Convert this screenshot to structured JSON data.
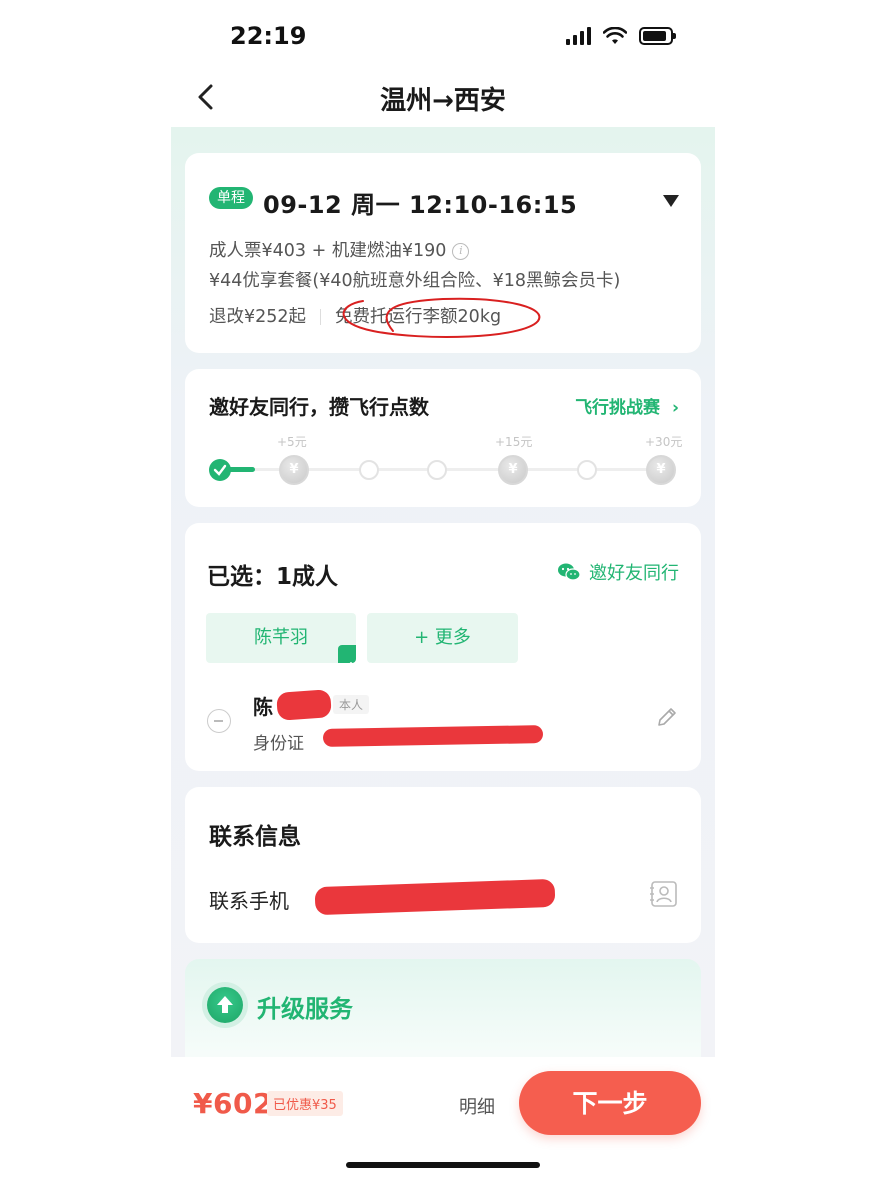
{
  "status_bar": {
    "time": "22:19"
  },
  "nav": {
    "title": "温州→西安"
  },
  "flight_card": {
    "trip_tag": "单程",
    "datetime": "09-12 周一 12:10-16:15",
    "price_line": "成人票¥403 + 机建燃油¥190",
    "package_line": "¥44优享套餐(¥40航班意外组合险、¥18黑鲸会员卡)",
    "refund": "退改¥252起",
    "baggage": "免费托运行李额20kg"
  },
  "invite_card": {
    "title": "邀好友同行，攒飞行点数",
    "challenge_link": "飞行挑战赛",
    "rewards": [
      "+5元",
      "+15元",
      "+30元"
    ],
    "coin_symbol": "¥"
  },
  "passenger_card": {
    "selected": "已选：1成人",
    "invite_friend": "邀好友同行",
    "chips": [
      "陈芊羽",
      "+ 更多"
    ],
    "passenger_name": "陈",
    "self_badge": "本人",
    "id_type": "身份证"
  },
  "contact_card": {
    "title": "联系信息",
    "phone_label": "联系手机"
  },
  "upgrade_card": {
    "title": "升级服务"
  },
  "footer": {
    "total": "¥602",
    "discount": "已优惠¥35",
    "detail": "明细",
    "next": "下一步"
  },
  "colors": {
    "accent": "#22b573",
    "price": "#f05a4a",
    "button": "#f55e4f"
  }
}
